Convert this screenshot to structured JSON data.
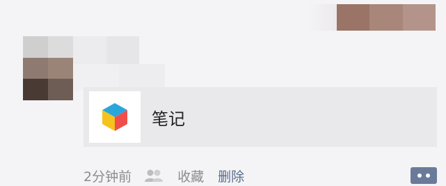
{
  "post": {
    "shared_card": {
      "title": "笔记",
      "icon": "notes-cube-icon"
    },
    "meta": {
      "time": "2分钟前",
      "visibility_icon": "people-icon",
      "favorite_label": "收藏",
      "delete_label": "删除"
    },
    "comment_icon": "comment-dots-icon"
  },
  "colors": {
    "card_background": "#e9e9ec",
    "meta_text": "#8c8c8c",
    "delete_link": "#5a6c8c",
    "comment_button": "#6a7a9a"
  }
}
